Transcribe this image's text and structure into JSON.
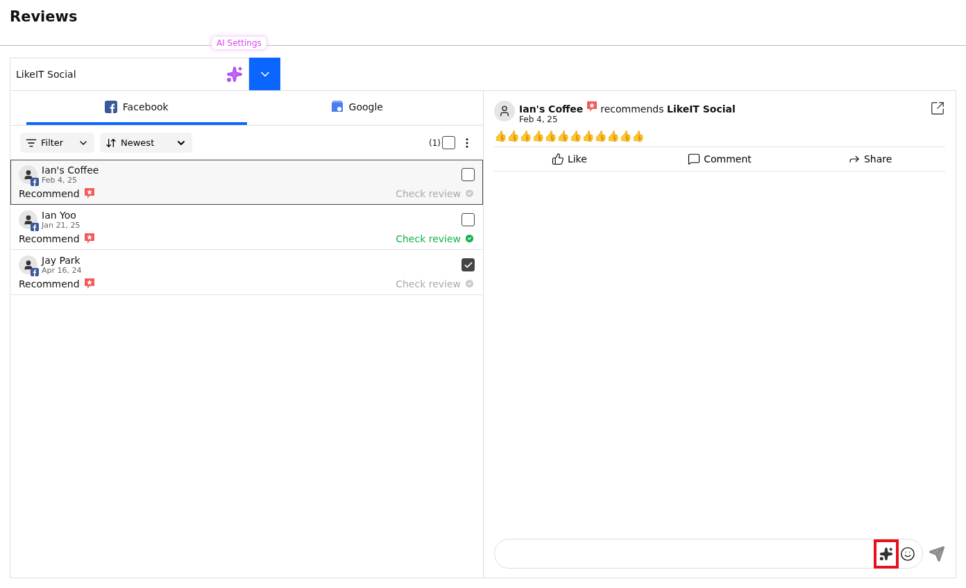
{
  "page": {
    "title": "Reviews"
  },
  "account": {
    "name": "LikeIT Social",
    "tooltip": "AI Settings"
  },
  "tabs": [
    {
      "label": "Facebook",
      "kind": "facebook",
      "selected": true
    },
    {
      "label": "Google",
      "kind": "google",
      "selected": false
    }
  ],
  "toolbar": {
    "filter": "Filter",
    "sort": "Newest",
    "selected_count": "(1)",
    "select_all": false
  },
  "reviews": [
    {
      "name": "Ian's Coffee",
      "date": "Feb 4, 25",
      "type": "Recommend",
      "status": "Check review",
      "checked_review": false,
      "selected": true,
      "checked": false
    },
    {
      "name": "Ian Yoo",
      "date": "Jan 21, 25",
      "type": "Recommend",
      "status": "Check review",
      "checked_review": true,
      "selected": false,
      "checked": false
    },
    {
      "name": "Jay Park",
      "date": "Apr 16, 24",
      "type": "Recommend",
      "status": "Check review",
      "checked_review": false,
      "selected": false,
      "checked": true
    }
  ],
  "detail": {
    "author": "Ian's Coffee",
    "verb": "recommends",
    "target": "LikeIT Social",
    "date": "Feb 4, 25",
    "text": "👍👍👍👍👍👍👍👍👍👍👍👍",
    "actions": [
      {
        "label": "Like",
        "kind": "like"
      },
      {
        "label": "Comment",
        "kind": "comment"
      },
      {
        "label": "Share",
        "kind": "share"
      }
    ]
  },
  "composer": {
    "ai_highlighted": true
  }
}
